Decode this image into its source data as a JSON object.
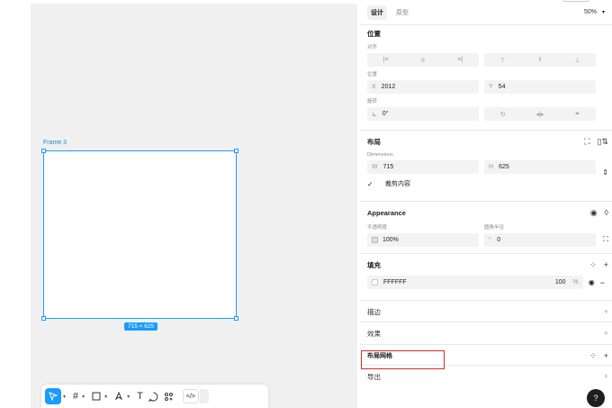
{
  "canvas": {
    "frame_label": "Frame 3",
    "size_badge": "715 × 625"
  },
  "toolbar": {
    "tools": [
      "move-tool",
      "frame-tool",
      "shape-tool",
      "pen-tool",
      "text-tool",
      "comment-tool",
      "components-tool",
      "code-tool"
    ],
    "text_glyph": "T",
    "code_glyph": "</>"
  },
  "panel": {
    "tabs": [
      "设计",
      "原型"
    ],
    "zoom": "50%",
    "position": {
      "title": "位置",
      "align_label": "对齐",
      "position_label": "位置",
      "x_prefix": "X",
      "x_value": "2012",
      "y_prefix": "Y",
      "y_value": "54",
      "rotation_label": "旋转",
      "rotation_value": "0°"
    },
    "layout": {
      "title": "布局",
      "dimensions_label": "Dimensions",
      "w_prefix": "W",
      "w_value": "715",
      "h_prefix": "H",
      "h_value": "625",
      "clip_label": "裁剪内容",
      "clip_checked": true
    },
    "appearance": {
      "title": "Appearance",
      "opacity_label": "不透明度",
      "opacity_value": "100%",
      "radius_label": "圆角半径",
      "radius_value": "0"
    },
    "fill": {
      "title": "填充",
      "hex": "FFFFFF",
      "opacity": "100",
      "percent": "%"
    },
    "stroke": {
      "title": "描边"
    },
    "effects": {
      "title": "效果"
    },
    "layout_grid": {
      "title": "布局网格"
    },
    "export": {
      "title": "导出"
    },
    "help": "?"
  },
  "colors": {
    "accent": "#1a9bff",
    "highlight": "#e0262c"
  }
}
